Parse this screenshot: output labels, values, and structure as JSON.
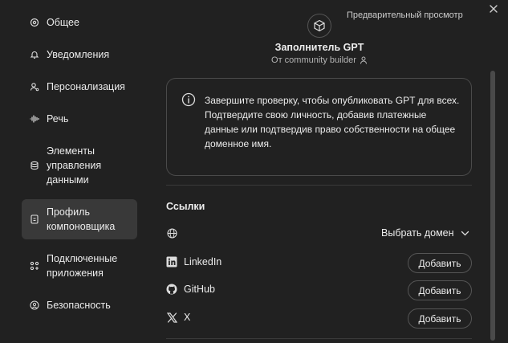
{
  "sidebar": {
    "items": [
      {
        "label": "Общее",
        "icon": "gear-icon"
      },
      {
        "label": "Уведомления",
        "icon": "bell-icon"
      },
      {
        "label": "Персонализация",
        "icon": "user-settings-icon"
      },
      {
        "label": "Речь",
        "icon": "waveform-icon"
      },
      {
        "label": "Элементы\nуправления\nданными",
        "icon": "database-icon"
      },
      {
        "label": "Профиль\nкомпоновщика",
        "icon": "id-card-icon",
        "active": true
      },
      {
        "label": "Подключенные\nприложения",
        "icon": "apps-grid-icon"
      },
      {
        "label": "Безопасность",
        "icon": "shield-icon"
      }
    ]
  },
  "header": {
    "preview_label": "Предварительный просмотр",
    "gpt_name": "Заполнитель GPT",
    "author": "От community builder"
  },
  "alert": {
    "line1": "Завершите проверку, чтобы опубликовать GPT для всех.",
    "line2": "Подтвердите свою личность, добавив платежные данные или подтвердив право собственности на общее доменное имя."
  },
  "links": {
    "title": "Ссылки",
    "domain_select": "Выбрать домен",
    "rows": [
      {
        "label": "LinkedIn",
        "button": "Добавить",
        "icon": "linkedin-icon"
      },
      {
        "label": "GitHub",
        "button": "Добавить",
        "icon": "github-icon"
      },
      {
        "label": "X",
        "button": "Добавить",
        "icon": "x-logo-icon"
      }
    ]
  },
  "colors": {
    "background": "#212121",
    "active_item": "#393939",
    "text": "#ececec",
    "muted": "#b4b4b4",
    "border": "#4a4a4a"
  }
}
